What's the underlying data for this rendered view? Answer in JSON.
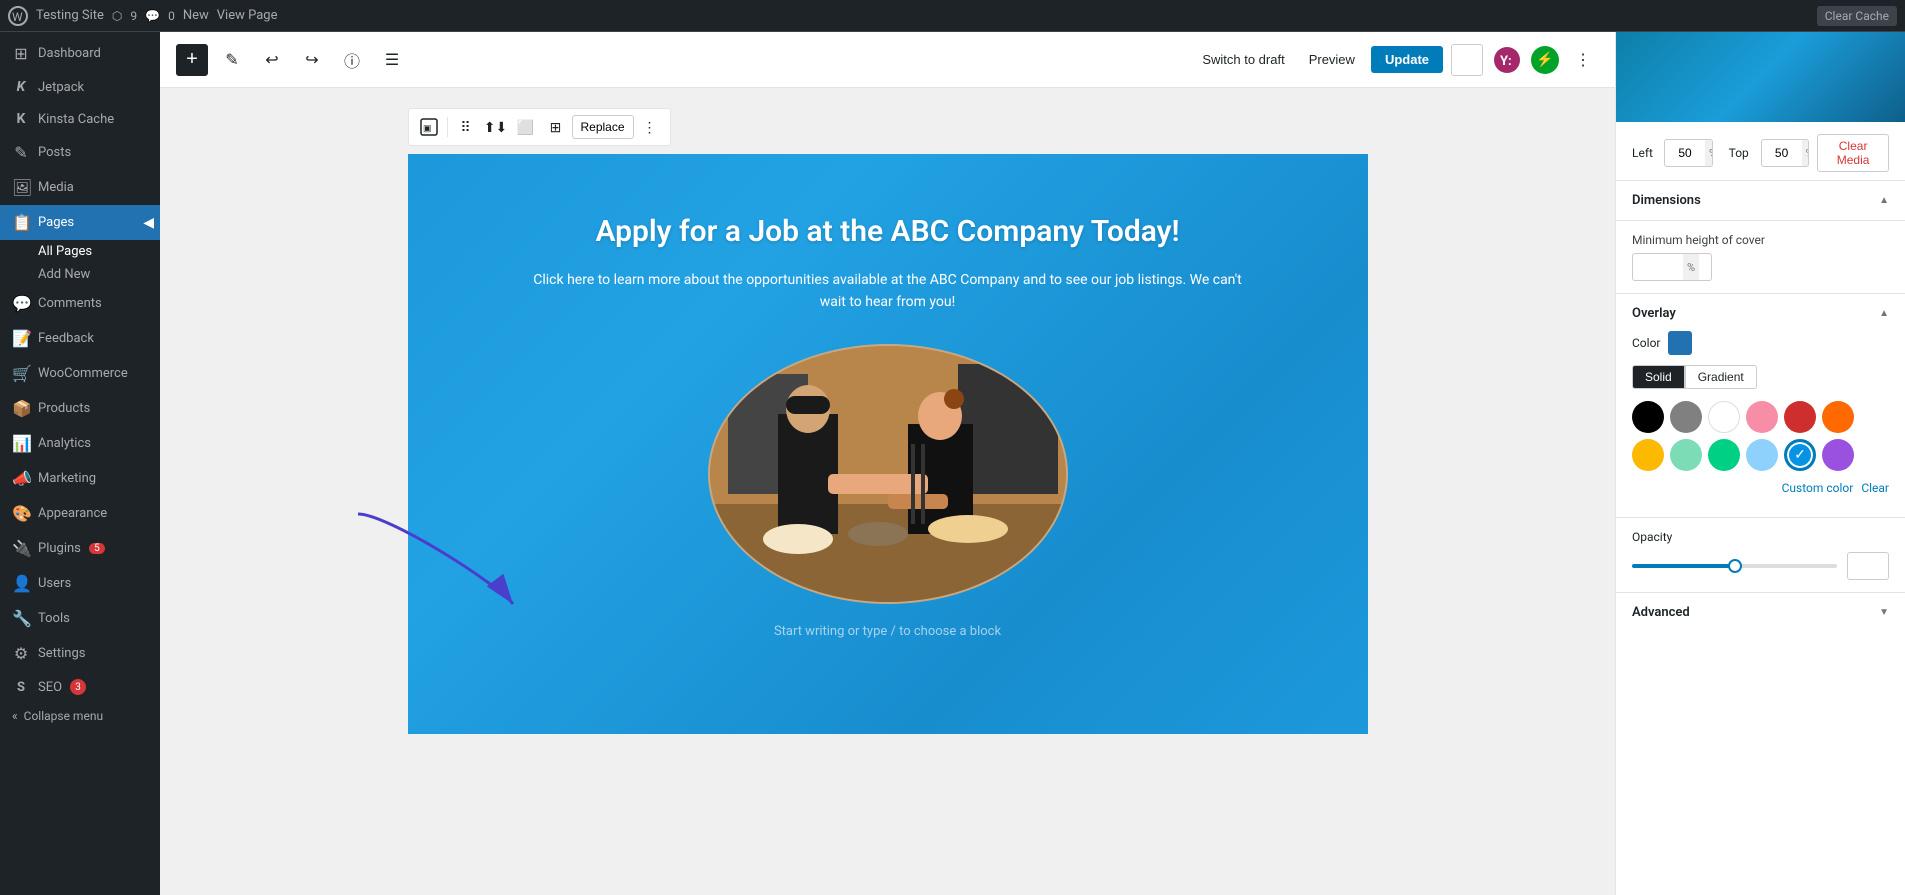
{
  "topbar": {
    "site_name": "Testing Site",
    "node_count": "9",
    "comment_count": "0",
    "new_label": "New",
    "view_page_label": "View Page",
    "clear_cache_label": "Clear Cache"
  },
  "sidebar": {
    "items": [
      {
        "id": "dashboard",
        "label": "Dashboard",
        "icon": "⊞"
      },
      {
        "id": "jetpack",
        "label": "Jetpack",
        "icon": "K"
      },
      {
        "id": "kinsta",
        "label": "Kinsta Cache",
        "icon": "K"
      },
      {
        "id": "posts",
        "label": "Posts",
        "icon": "📄"
      },
      {
        "id": "media",
        "label": "Media",
        "icon": "🖼"
      },
      {
        "id": "pages",
        "label": "Pages",
        "icon": "📋",
        "active": true
      },
      {
        "id": "comments",
        "label": "Comments",
        "icon": "💬"
      },
      {
        "id": "feedback",
        "label": "Feedback",
        "icon": "📝"
      },
      {
        "id": "woocommerce",
        "label": "WooCommerce",
        "icon": "🛒"
      },
      {
        "id": "products",
        "label": "Products",
        "icon": "📦"
      },
      {
        "id": "analytics",
        "label": "Analytics",
        "icon": "📊"
      },
      {
        "id": "marketing",
        "label": "Marketing",
        "icon": "📣"
      },
      {
        "id": "appearance",
        "label": "Appearance",
        "icon": "🎨"
      },
      {
        "id": "plugins",
        "label": "Plugins",
        "icon": "🔌",
        "badge": "5"
      },
      {
        "id": "users",
        "label": "Users",
        "icon": "👤"
      },
      {
        "id": "tools",
        "label": "Tools",
        "icon": "🔧"
      },
      {
        "id": "settings",
        "label": "Settings",
        "icon": "⚙"
      },
      {
        "id": "seo",
        "label": "SEO",
        "icon": "S",
        "badge": "3"
      }
    ],
    "sub_pages": [
      {
        "id": "all-pages",
        "label": "All Pages",
        "active": true
      },
      {
        "id": "add-new",
        "label": "Add New"
      }
    ],
    "collapse_label": "Collapse menu"
  },
  "editor": {
    "toolbar": {
      "switch_to_draft_label": "Switch to draft",
      "preview_label": "Preview",
      "update_label": "Update"
    },
    "block_toolbar": {
      "replace_label": "Replace"
    },
    "cover": {
      "title": "Apply for a Job at the ABC Company Today!",
      "description": "Click here to learn more about the opportunities available at the ABC Company and to see our job listings. We can't wait to hear from you!",
      "placeholder": "Start writing or type / to choose a block"
    }
  },
  "right_panel": {
    "position": {
      "left_label": "Left",
      "left_value": "50",
      "left_unit": "%",
      "top_label": "Top",
      "top_value": "50",
      "top_unit": "%",
      "clear_media_label": "Clear Media"
    },
    "dimensions": {
      "title": "Dimensions",
      "min_height_label": "Minimum height of cover",
      "min_height_unit": "%"
    },
    "overlay": {
      "title": "Overlay",
      "color_label": "Color",
      "solid_label": "Solid",
      "gradient_label": "Gradient",
      "swatches": [
        {
          "id": "black",
          "class": "swatch-black"
        },
        {
          "id": "gray",
          "class": "swatch-gray"
        },
        {
          "id": "white",
          "class": "swatch-white"
        },
        {
          "id": "pink",
          "class": "swatch-pink"
        },
        {
          "id": "red",
          "class": "swatch-red"
        },
        {
          "id": "orange",
          "class": "swatch-orange"
        },
        {
          "id": "yellow",
          "class": "swatch-yellow"
        },
        {
          "id": "green-light",
          "class": "swatch-green-light"
        },
        {
          "id": "green",
          "class": "swatch-green"
        },
        {
          "id": "blue-light",
          "class": "swatch-blue-light"
        },
        {
          "id": "blue",
          "class": "swatch-blue",
          "selected": true
        },
        {
          "id": "purple",
          "class": "swatch-purple"
        }
      ],
      "custom_color_label": "Custom color",
      "clear_label": "Clear"
    },
    "opacity": {
      "title": "Opacity",
      "value": "50",
      "slider_percent": 50
    },
    "advanced": {
      "title": "Advanced"
    }
  }
}
